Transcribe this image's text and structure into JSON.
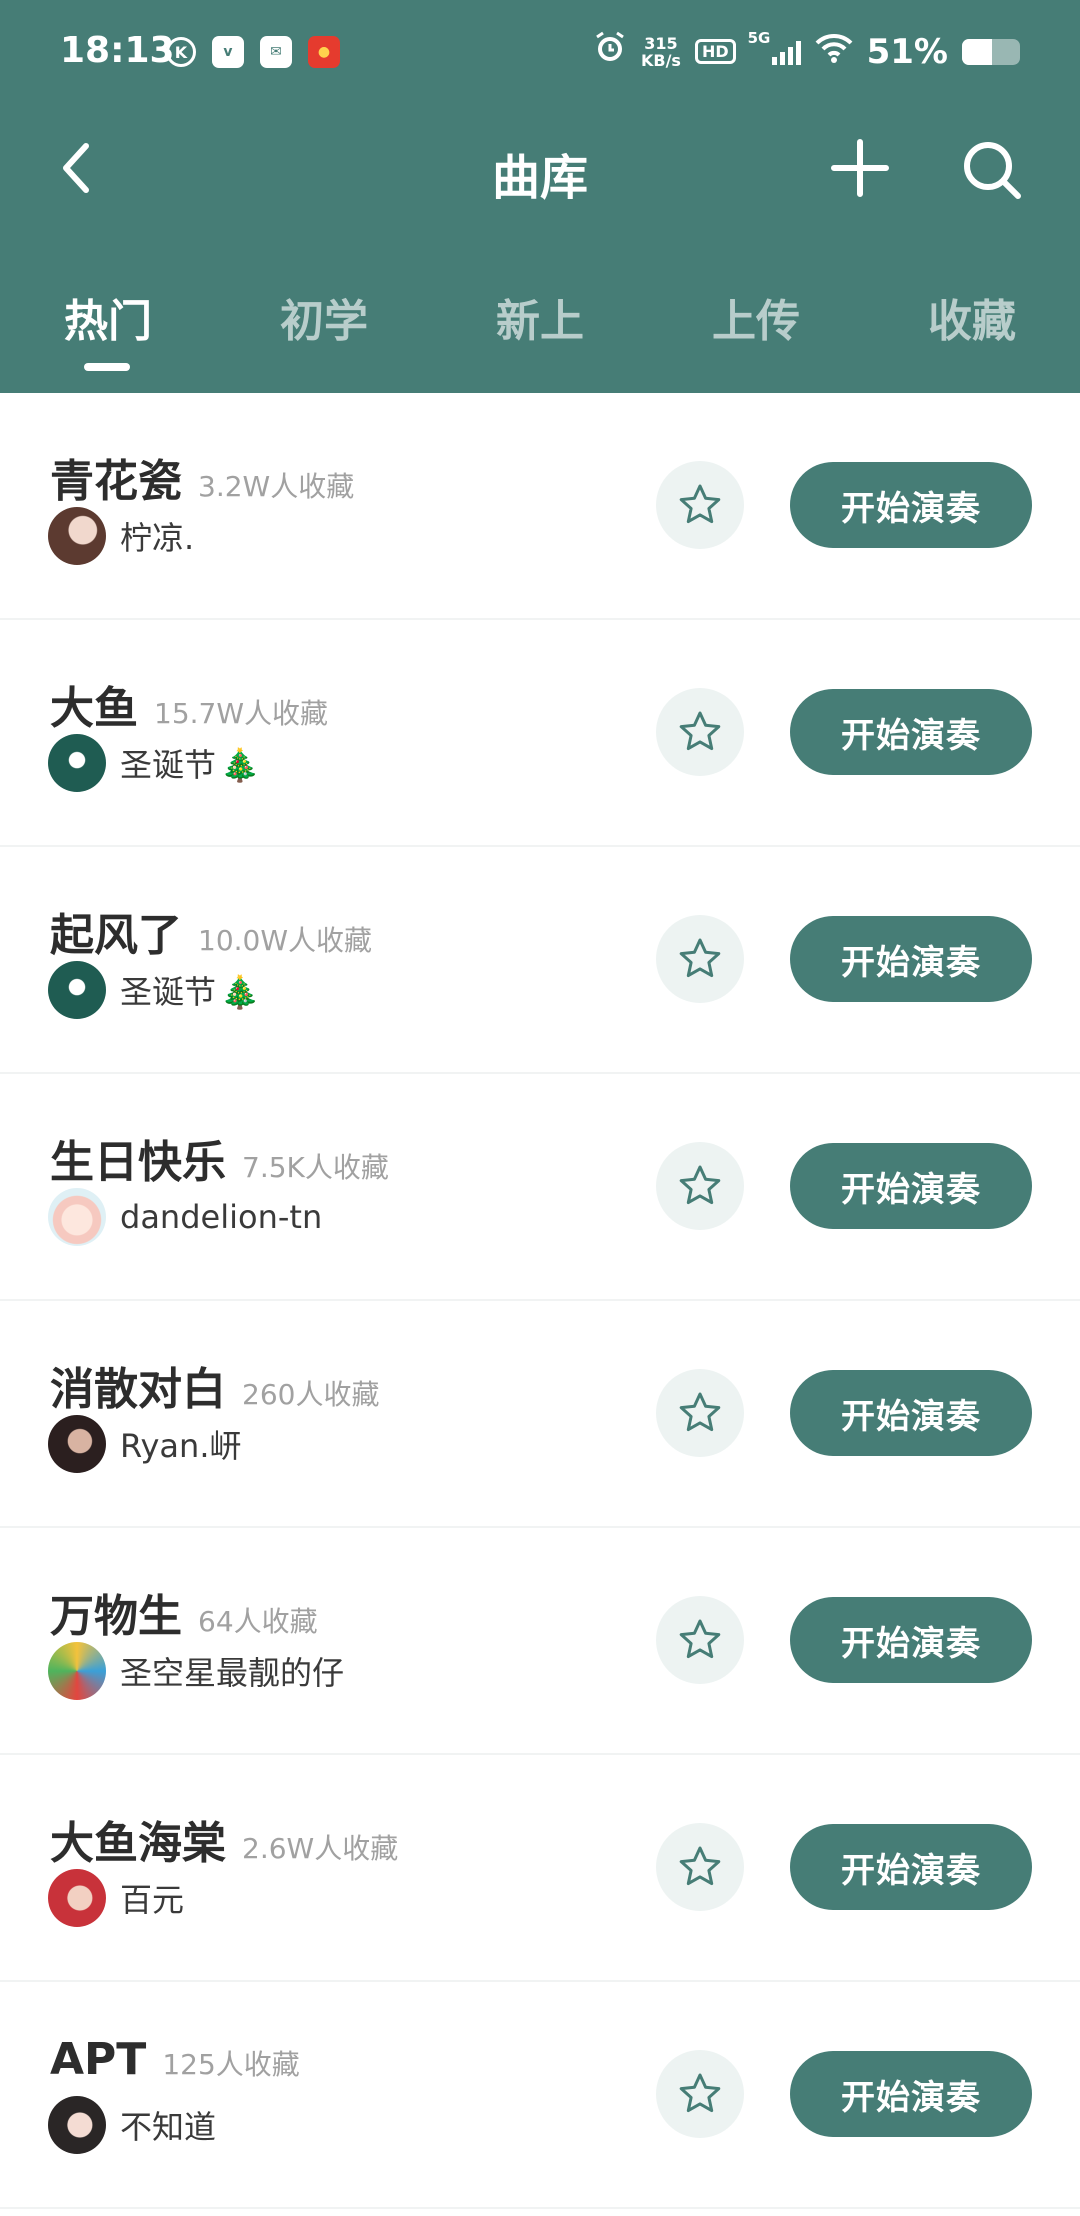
{
  "status_bar": {
    "time": "18:13",
    "net_speed_top": "315",
    "net_speed_bottom": "KB/s",
    "hd": "HD",
    "network": "5G",
    "battery": "51%",
    "battery_level": 0.51
  },
  "nav": {
    "title": "曲库"
  },
  "tabs": [
    {
      "label": "热门"
    },
    {
      "label": "初学"
    },
    {
      "label": "新上"
    },
    {
      "label": "上传"
    },
    {
      "label": "收藏"
    }
  ],
  "active_tab": 0,
  "songs": [
    {
      "title": "青花瓷",
      "favorites": "3.2W人收藏",
      "user": "柠凉.",
      "action": "开始演奏"
    },
    {
      "title": "大鱼",
      "favorites": "15.7W人收藏",
      "user": "圣诞节",
      "user_emoji": "🎄",
      "action": "开始演奏"
    },
    {
      "title": "起风了",
      "favorites": "10.0W人收藏",
      "user": "圣诞节",
      "user_emoji": "🎄",
      "action": "开始演奏"
    },
    {
      "title": "生日快乐",
      "favorites": "7.5K人收藏",
      "user": "dandelion-tn",
      "action": "开始演奏"
    },
    {
      "title": "消散对白",
      "favorites": "260人收藏",
      "user": "Ryan.岍",
      "action": "开始演奏"
    },
    {
      "title": "万物生",
      "favorites": "64人收藏",
      "user": "圣空星最靓的仔",
      "action": "开始演奏"
    },
    {
      "title": "大鱼海棠",
      "favorites": "2.6W人收藏",
      "user": "百元",
      "action": "开始演奏"
    },
    {
      "title": "APT",
      "favorites": "125人收藏",
      "user": "不知道",
      "action": "开始演奏"
    }
  ],
  "colors": {
    "primary": "#467d76",
    "star_bg": "#edf3f2"
  }
}
